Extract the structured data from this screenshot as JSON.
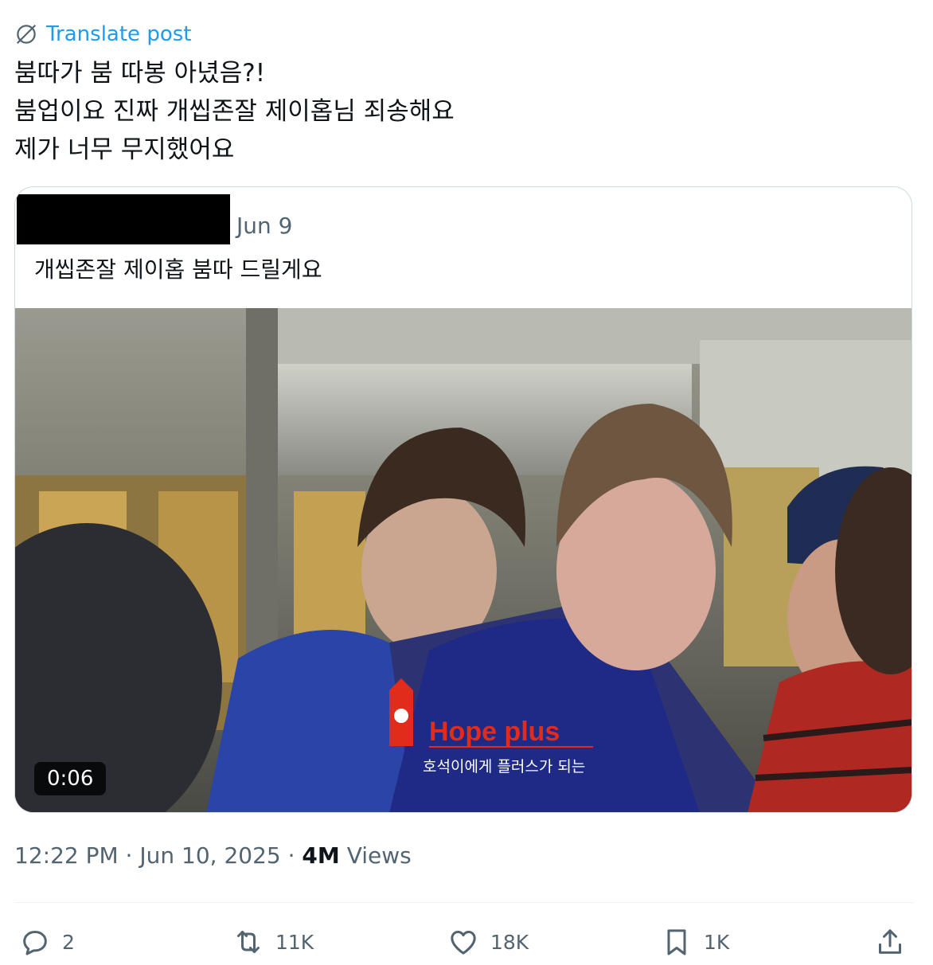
{
  "translate": {
    "label": "Translate post",
    "icon": "translate-icon"
  },
  "post": {
    "lines": [
      "붐따가 붐 따봉 아녔음?!",
      "붐업이요 진짜 개씹존잘 제이홉님 죄송해요",
      "제가 너무 무지했어요"
    ]
  },
  "quote": {
    "date": "Jun 9",
    "text": "개씹존잘 제이홉 붐따 드릴게요",
    "video": {
      "timestamp": "0:06",
      "watermark": {
        "title": "Hope plus",
        "subtitle": "호석이에게 플러스가 되는"
      }
    }
  },
  "meta": {
    "time": "12:22 PM",
    "separator": "·",
    "date": "Jun 10, 2025",
    "views_count": "4M",
    "views_label": "Views"
  },
  "actions": {
    "replies": {
      "icon": "reply-icon",
      "count": "2"
    },
    "reposts": {
      "icon": "repost-icon",
      "count": "11K"
    },
    "likes": {
      "icon": "like-icon",
      "count": "18K"
    },
    "bookmarks": {
      "icon": "bookmark-icon",
      "count": "1K"
    },
    "share": {
      "icon": "share-icon"
    }
  },
  "colors": {
    "link": "#1d9bf0",
    "secondary_text": "#536471",
    "primary_text": "#0f1419",
    "border": "#cfd9de"
  }
}
